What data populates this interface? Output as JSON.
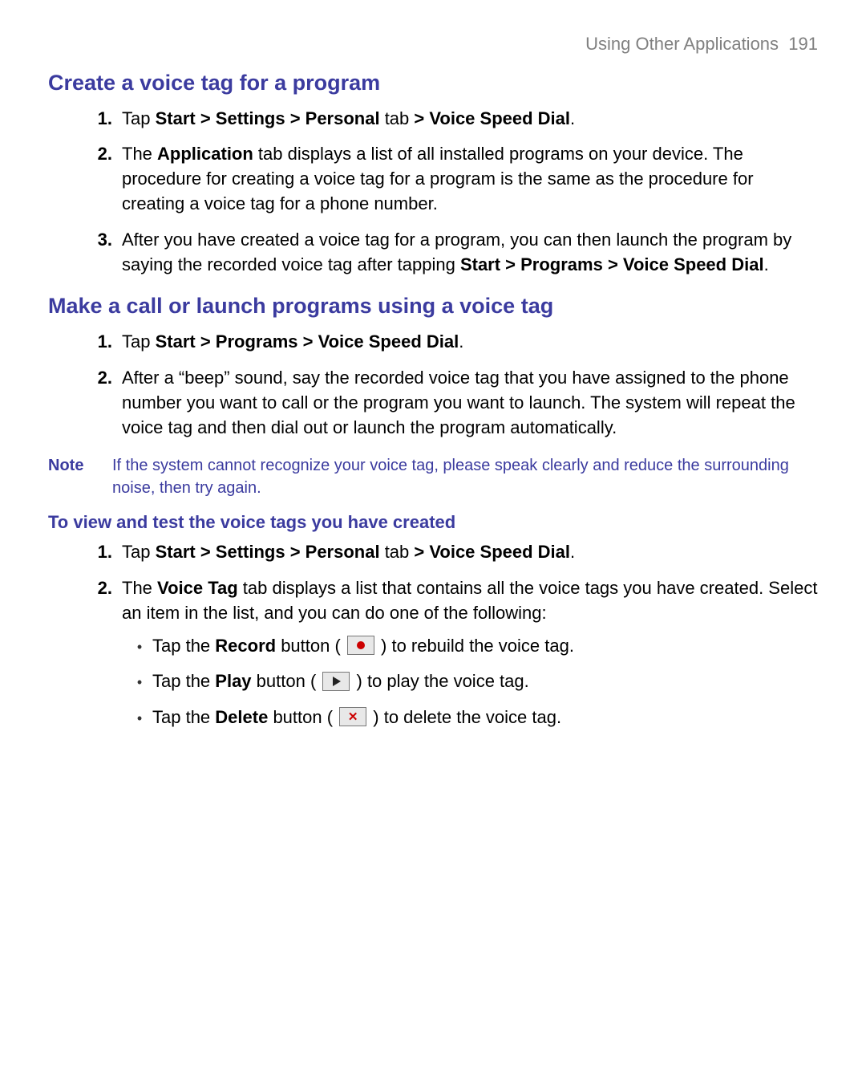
{
  "header": {
    "section": "Using Other Applications",
    "page": "191"
  },
  "sec1": {
    "heading": "Create a voice tag for a program",
    "items": {
      "1": {
        "num": "1.",
        "pre": "Tap ",
        "path1": "Start > Settings > Personal",
        "mid": " tab ",
        "path2": "> Voice Speed Dial",
        "post": "."
      },
      "2": {
        "num": "2.",
        "pre": "The ",
        "b": "Application",
        "post": " tab displays a list of all installed programs on your device. The procedure for creating a voice tag for a program is the same as the procedure for creating a voice tag for a phone number."
      },
      "3": {
        "num": "3.",
        "pre": "After you have created a voice tag for a program, you can then launch the program by saying the recorded voice tag after tapping ",
        "b": "Start > Programs > Voice Speed Dial",
        "post": "."
      }
    }
  },
  "sec2": {
    "heading": "Make a call or launch programs using a voice tag",
    "items": {
      "1": {
        "num": "1.",
        "pre": "Tap ",
        "b": "Start > Programs > Voice Speed Dial",
        "post": "."
      },
      "2": {
        "num": "2.",
        "text": "After a “beep” sound, say the recorded voice tag that you have assigned to the phone number you want to call or the program you want to launch. The system will repeat the voice tag and then dial out or launch the program automatically."
      }
    }
  },
  "note": {
    "label": "Note",
    "text": "If the system cannot recognize your voice tag, please speak clearly and reduce the surrounding noise, then try again."
  },
  "sec3": {
    "heading": "To view and test the voice tags you have created",
    "items": {
      "1": {
        "num": "1.",
        "pre": "Tap ",
        "path1": "Start > Settings > Personal",
        "mid": " tab ",
        "path2": "> Voice Speed Dial",
        "post": "."
      },
      "2": {
        "num": "2.",
        "pre": "The ",
        "b": "Voice Tag",
        "post": " tab displays a list that contains all the voice tags you have created. Select an item in the list, and you can do one of the following:"
      }
    },
    "bullets": {
      "dot": "•",
      "b1": {
        "pre": "Tap the ",
        "b": "Record",
        "mid": " button ( ",
        "post": " ) to rebuild the voice tag."
      },
      "b2": {
        "pre": "Tap the ",
        "b": "Play",
        "mid": " button ( ",
        "post": " ) to play the voice tag."
      },
      "b3": {
        "pre": "Tap the ",
        "b": "Delete",
        "mid": " button ( ",
        "post": " ) to delete the voice tag."
      }
    }
  }
}
